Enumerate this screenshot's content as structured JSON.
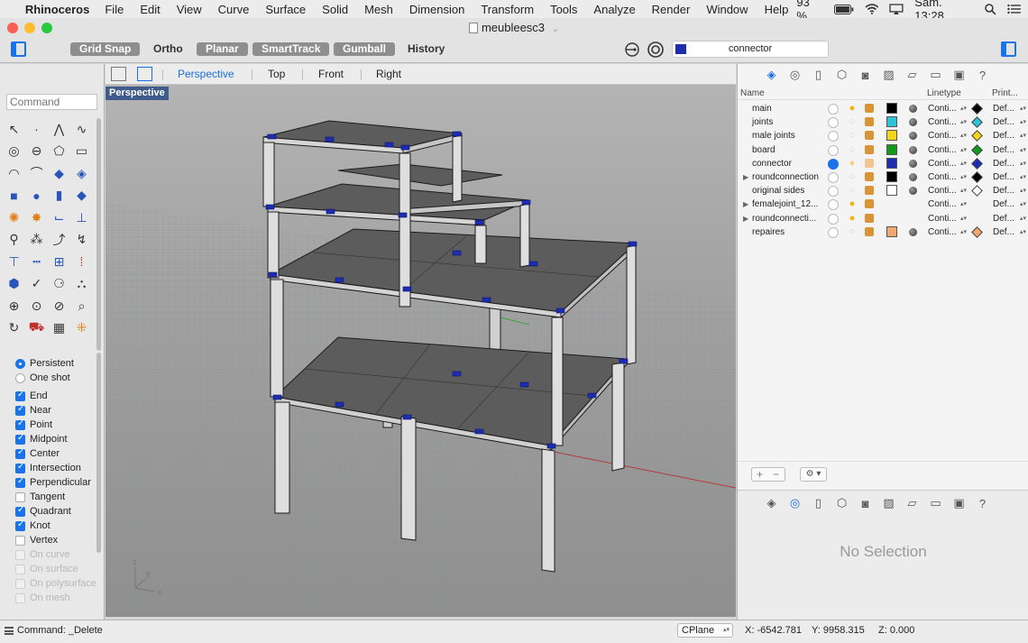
{
  "menubar": {
    "app_name": "Rhinoceros",
    "items": [
      "File",
      "Edit",
      "View",
      "Curve",
      "Surface",
      "Solid",
      "Mesh",
      "Dimension",
      "Transform",
      "Tools",
      "Analyze",
      "Render",
      "Window",
      "Help"
    ],
    "battery": "93 %",
    "clock": "Sam. 13:28"
  },
  "window": {
    "title": "meubleesc3"
  },
  "toolbar": {
    "grid_snap": "Grid Snap",
    "ortho": "Ortho",
    "planar": "Planar",
    "smarttrack": "SmartTrack",
    "gumball": "Gumball",
    "history": "History",
    "current_layer": "connector",
    "current_layer_color": "#1d2db0"
  },
  "command_box": {
    "placeholder": "Command"
  },
  "osnap": {
    "mode": [
      {
        "label": "Persistent",
        "on": true
      },
      {
        "label": "One shot",
        "on": false
      }
    ],
    "items": [
      {
        "label": "End",
        "on": true
      },
      {
        "label": "Near",
        "on": true
      },
      {
        "label": "Point",
        "on": true
      },
      {
        "label": "Midpoint",
        "on": true
      },
      {
        "label": "Center",
        "on": true
      },
      {
        "label": "Intersection",
        "on": true
      },
      {
        "label": "Perpendicular",
        "on": true
      },
      {
        "label": "Tangent",
        "on": false
      },
      {
        "label": "Quadrant",
        "on": true
      },
      {
        "label": "Knot",
        "on": true
      },
      {
        "label": "Vertex",
        "on": false
      },
      {
        "label": "On curve",
        "on": false,
        "disabled": true
      },
      {
        "label": "On surface",
        "on": false,
        "disabled": true
      },
      {
        "label": "On polysurface",
        "on": false,
        "disabled": true
      },
      {
        "label": "On mesh",
        "on": false,
        "disabled": true
      }
    ]
  },
  "viewport_tabs": {
    "tabs": [
      "Perspective",
      "Top",
      "Front",
      "Right"
    ],
    "active": "Perspective"
  },
  "viewport": {
    "label": "Perspective",
    "axis_labels": {
      "x": "x",
      "y": "y",
      "z": "z"
    }
  },
  "layers": {
    "headers": {
      "name": "Name",
      "linetype": "Linetype",
      "print": "Print..."
    },
    "rows": [
      {
        "name": "main",
        "bulb": true,
        "lock_pale": false,
        "color": "#000000",
        "linetype": "Conti...",
        "print_color": "#000000",
        "print_width": "Def...",
        "expand": false,
        "current": false,
        "material": true
      },
      {
        "name": "joints",
        "bulb": false,
        "lock_pale": false,
        "color": "#30c2d6",
        "linetype": "Conti...",
        "print_color": "#30c2d6",
        "print_width": "Def...",
        "expand": false,
        "current": false,
        "material": true
      },
      {
        "name": "male joints",
        "bulb": false,
        "lock_pale": false,
        "color": "#f2d41c",
        "linetype": "Conti...",
        "print_color": "#f2d41c",
        "print_width": "Def...",
        "expand": false,
        "current": false,
        "material": true
      },
      {
        "name": "board",
        "bulb": false,
        "lock_pale": false,
        "color": "#139a1e",
        "linetype": "Conti...",
        "print_color": "#139a1e",
        "print_width": "Def...",
        "expand": false,
        "current": false,
        "material": true
      },
      {
        "name": "connector",
        "bulb": false,
        "lock_pale": true,
        "color": "#1d2db0",
        "linetype": "Conti...",
        "print_color": "#1d2db0",
        "print_width": "Def...",
        "expand": false,
        "current": true,
        "material": true
      },
      {
        "name": "roundconnection",
        "bulb": false,
        "lock_pale": false,
        "color": "#000000",
        "linetype": "Conti...",
        "print_color": "#000000",
        "print_width": "Def...",
        "expand": true,
        "current": false,
        "material": true
      },
      {
        "name": "original sides",
        "bulb": false,
        "lock_pale": false,
        "color": "#ffffff",
        "linetype": "Conti...",
        "print_color": "#ffffff",
        "print_width": "Def...",
        "expand": false,
        "current": false,
        "material": true
      },
      {
        "name": "femalejoint_12...",
        "bulb": true,
        "lock_pale": false,
        "color": "",
        "linetype": "Conti...",
        "print_color": "",
        "print_width": "Def...",
        "expand": true,
        "current": false,
        "material": false
      },
      {
        "name": "roundconnecti...",
        "bulb": true,
        "lock_pale": false,
        "color": "",
        "linetype": "Conti...",
        "print_color": "",
        "print_width": "Def...",
        "expand": true,
        "current": false,
        "material": false
      },
      {
        "name": "repaires",
        "bulb": false,
        "lock_pale": false,
        "color": "#f0a872",
        "linetype": "Conti...",
        "print_color": "#f0a872",
        "print_width": "Def...",
        "expand": false,
        "current": false,
        "material": true
      }
    ]
  },
  "properties": {
    "no_selection": "No Selection"
  },
  "statusbar": {
    "command": "Command: _Delete",
    "cplane": "CPlane",
    "x": "X: -6542.781",
    "y": "Y: 9958.315",
    "z": "Z: 0.000"
  },
  "colors": {
    "accent": "#1a73e8",
    "connector_blue": "#1d2db0",
    "viewport_bg": "#9a9a9a",
    "board_fill": "#5c5c5c"
  }
}
